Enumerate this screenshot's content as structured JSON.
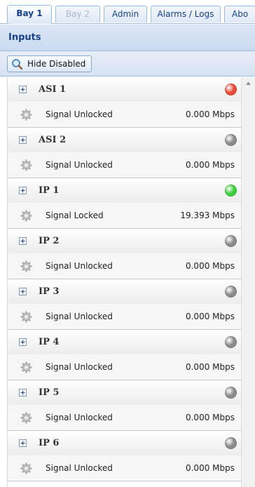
{
  "tabs": [
    {
      "label": "Bay 1",
      "state": "active"
    },
    {
      "label": "Bay 2",
      "state": "disabled"
    },
    {
      "label": "Admin",
      "state": "normal"
    },
    {
      "label": "Alarms / Logs",
      "state": "normal"
    },
    {
      "label": "Abo",
      "state": "normal"
    }
  ],
  "panel": {
    "title": "Inputs"
  },
  "toolbar": {
    "hide_disabled_label": "Hide Disabled",
    "icon": "search-icon"
  },
  "colors": {
    "led_red": "#e84a3a",
    "led_green": "#3fcf3f",
    "led_gray": "#8c8c8c",
    "accent": "#15428b"
  },
  "inputs": [
    {
      "name": "ASI 1",
      "status": "Signal Unlocked",
      "rate": "0.000 Mbps",
      "led": "red"
    },
    {
      "name": "ASI 2",
      "status": "Signal Unlocked",
      "rate": "0.000 Mbps",
      "led": "gray"
    },
    {
      "name": "IP 1",
      "status": "Signal Locked",
      "rate": "19.393 Mbps",
      "led": "green"
    },
    {
      "name": "IP 2",
      "status": "Signal Unlocked",
      "rate": "0.000 Mbps",
      "led": "gray"
    },
    {
      "name": "IP 3",
      "status": "Signal Unlocked",
      "rate": "0.000 Mbps",
      "led": "gray"
    },
    {
      "name": "IP 4",
      "status": "Signal Unlocked",
      "rate": "0.000 Mbps",
      "led": "gray"
    },
    {
      "name": "IP 5",
      "status": "Signal Unlocked",
      "rate": "0.000 Mbps",
      "led": "gray"
    },
    {
      "name": "IP 6",
      "status": "Signal Unlocked",
      "rate": "0.000 Mbps",
      "led": "gray"
    }
  ]
}
